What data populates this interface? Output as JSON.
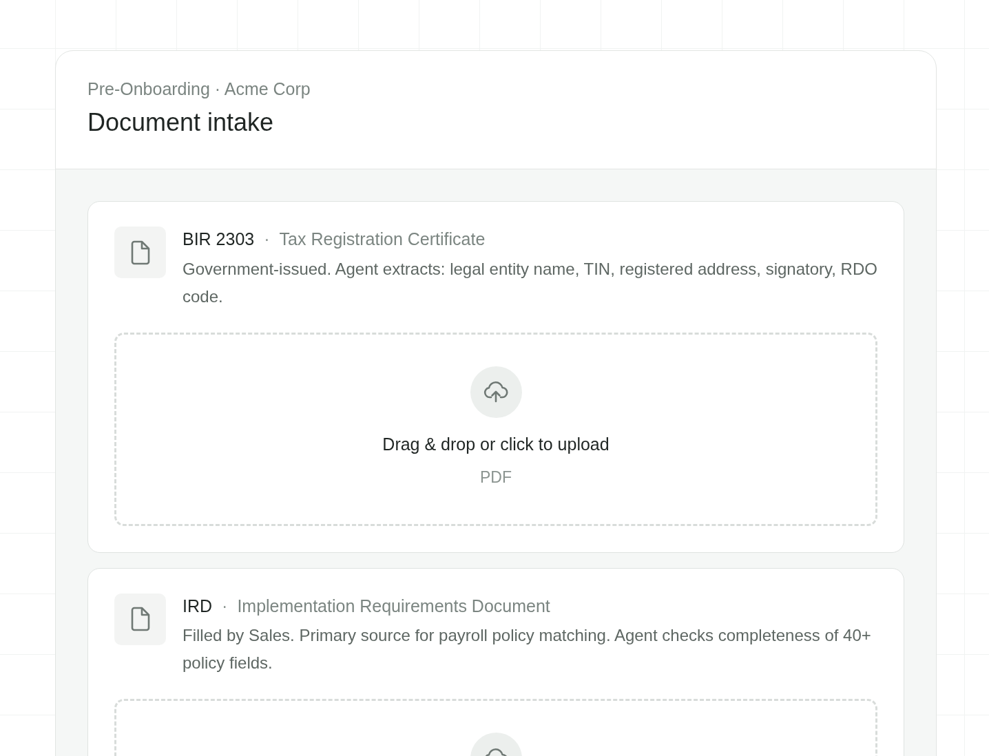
{
  "header": {
    "breadcrumb": "Pre-Onboarding · Acme Corp",
    "title": "Document intake"
  },
  "documents": [
    {
      "code": "BIR 2303",
      "separator": "·",
      "name": "Tax Registration Certificate",
      "description": "Government-issued. Agent extracts: legal entity name, TIN, registered address, signatory, RDO code.",
      "upload": {
        "prompt": "Drag & drop or click to upload",
        "formats": "PDF"
      }
    },
    {
      "code": "IRD",
      "separator": "·",
      "name": "Implementation Requirements Document",
      "description": "Filled by Sales. Primary source for payroll policy matching. Agent checks completeness of 40+ policy fields."
    }
  ]
}
